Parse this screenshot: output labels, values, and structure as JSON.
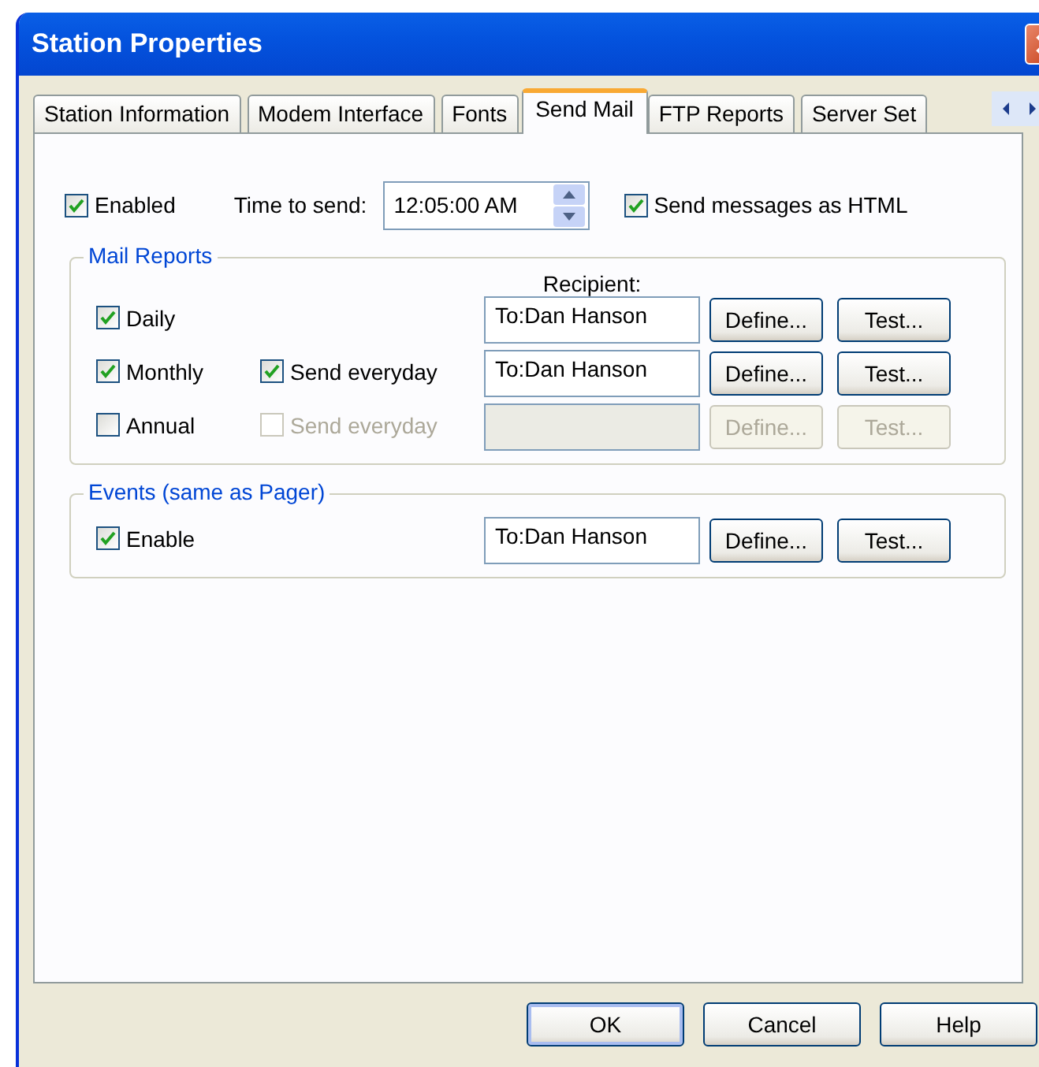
{
  "window": {
    "title": "Station Properties"
  },
  "tabs": [
    {
      "label": "Station Information",
      "selected": false
    },
    {
      "label": "Modem Interface",
      "selected": false
    },
    {
      "label": "Fonts",
      "selected": false
    },
    {
      "label": "Send Mail",
      "selected": true
    },
    {
      "label": "FTP Reports",
      "selected": false
    },
    {
      "label": "Server Set",
      "selected": false
    }
  ],
  "general": {
    "enabled": {
      "label": "Enabled",
      "checked": true
    },
    "time_label": "Time to send:",
    "time_value": "12:05:00 AM",
    "html": {
      "label": "Send messages as HTML",
      "checked": true
    }
  },
  "mail_reports": {
    "legend": "Mail Reports",
    "recipient_header": "Recipient:",
    "rows": [
      {
        "label": "Daily",
        "checked": true,
        "recipient": "To:Dan Hanson",
        "define": "Define...",
        "test": "Test...",
        "disabled": false
      },
      {
        "label": "Monthly",
        "checked": true,
        "send_everyday": {
          "label": "Send everyday",
          "checked": true,
          "disabled": false
        },
        "recipient": "To:Dan Hanson",
        "define": "Define...",
        "test": "Test...",
        "disabled": false
      },
      {
        "label": "Annual",
        "checked": false,
        "send_everyday": {
          "label": "Send everyday",
          "checked": false,
          "disabled": true
        },
        "define": "Define...",
        "test": "Test...",
        "disabled": true
      }
    ]
  },
  "events": {
    "legend": "Events (same as Pager)",
    "rows": [
      {
        "label": "Enable",
        "checked": true,
        "recipient": "To:Dan Hanson",
        "define": "Define...",
        "test": "Test...",
        "disabled": false
      }
    ]
  },
  "buttons": [
    {
      "label": "OK",
      "default": true
    },
    {
      "label": "Cancel",
      "default": false
    },
    {
      "label": "Help",
      "default": false
    }
  ]
}
